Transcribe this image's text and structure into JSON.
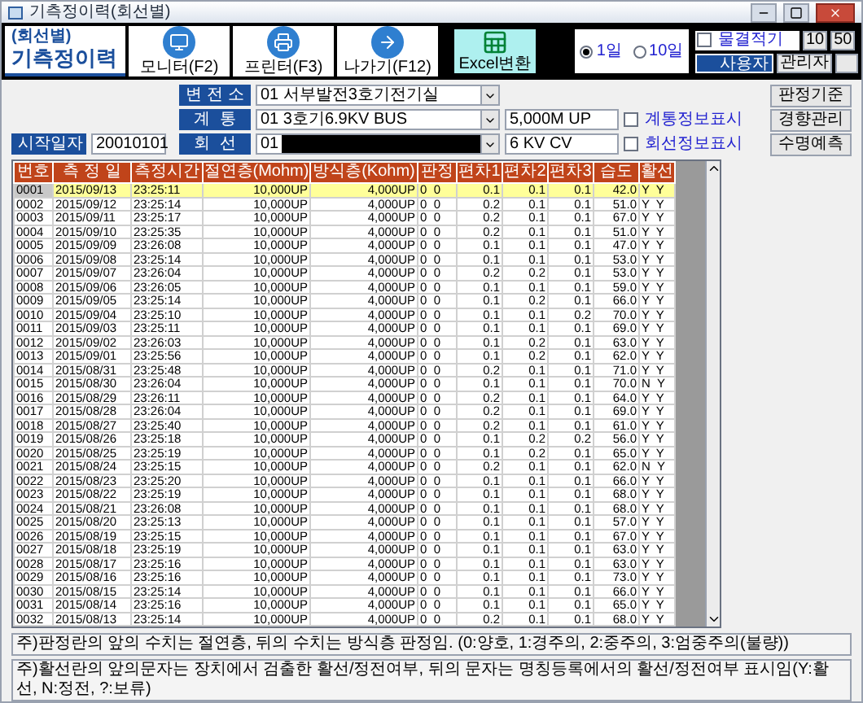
{
  "window": {
    "title": "기측정이력(회선별)"
  },
  "header": {
    "subtitle": "(회선별)",
    "title": "기측정이력"
  },
  "toolbar": [
    {
      "label": "모니터(F2)",
      "kind": "monitor"
    },
    {
      "label": "프린터(F3)",
      "kind": "printer"
    },
    {
      "label": "나가기(F12)",
      "kind": "exit"
    },
    {
      "label": "Excel변환",
      "kind": "excel"
    }
  ],
  "period": [
    {
      "label": "1일",
      "selected": true
    },
    {
      "label": "10일",
      "selected": false
    }
  ],
  "top_right": {
    "checkbox": {
      "label": "물결적기",
      "checked": false
    },
    "values": [
      "10",
      "50"
    ],
    "user_label": "사용자",
    "user": "관리자"
  },
  "filters": {
    "substation": {
      "label": "변 전 소",
      "value": "01 서부발전3호기전기실"
    },
    "system": {
      "label": "계  통",
      "value": "01 3호기6.9KV BUS",
      "info": "5,000M UP",
      "checkbox": {
        "label": "계통정보표시",
        "checked": false
      }
    },
    "start_date": {
      "label": "시작일자",
      "value": "20010101"
    },
    "line": {
      "label": "회  선",
      "value": "01",
      "info": "6 KV CV",
      "checkbox": {
        "label": "회선정보표시",
        "checked": false
      }
    }
  },
  "side_buttons": [
    "판정기준",
    "경향관리",
    "수명예측"
  ],
  "table": {
    "columns": [
      {
        "label": "번호",
        "kind": "text"
      },
      {
        "label": "측 정 일",
        "kind": "text"
      },
      {
        "label": "측정시간",
        "kind": "text"
      },
      {
        "label": "절연층(Mohm)",
        "kind": "number"
      },
      {
        "label": "방식층(Kohm)",
        "kind": "number"
      },
      {
        "label": "판정",
        "kind": "pair"
      },
      {
        "label": "편차1",
        "kind": "number"
      },
      {
        "label": "편차2",
        "kind": "number"
      },
      {
        "label": "편차3",
        "kind": "number"
      },
      {
        "label": "습도",
        "kind": "number"
      },
      {
        "label": "활선",
        "kind": "pair"
      }
    ],
    "rows": [
      {
        "selected": true,
        "cells": [
          "0001",
          "2015/09/13",
          "23:25:11",
          "10,000UP",
          "4,000UP",
          "0  0",
          "0.1",
          "0.1",
          "0.1",
          "42.0",
          "Y  Y"
        ]
      },
      {
        "selected": false,
        "cells": [
          "0002",
          "2015/09/12",
          "23:25:14",
          "10,000UP",
          "4,000UP",
          "0  0",
          "0.2",
          "0.1",
          "0.1",
          "51.0",
          "Y  Y"
        ]
      },
      {
        "selected": false,
        "cells": [
          "0003",
          "2015/09/11",
          "23:25:17",
          "10,000UP",
          "4,000UP",
          "0  0",
          "0.2",
          "0.1",
          "0.1",
          "67.0",
          "Y  Y"
        ]
      },
      {
        "selected": false,
        "cells": [
          "0004",
          "2015/09/10",
          "23:25:35",
          "10,000UP",
          "4,000UP",
          "0  0",
          "0.2",
          "0.1",
          "0.1",
          "51.0",
          "Y  Y"
        ]
      },
      {
        "selected": false,
        "cells": [
          "0005",
          "2015/09/09",
          "23:26:08",
          "10,000UP",
          "4,000UP",
          "0  0",
          "0.1",
          "0.1",
          "0.1",
          "47.0",
          "Y  Y"
        ]
      },
      {
        "selected": false,
        "cells": [
          "0006",
          "2015/09/08",
          "23:25:14",
          "10,000UP",
          "4,000UP",
          "0  0",
          "0.1",
          "0.1",
          "0.1",
          "53.0",
          "Y  Y"
        ]
      },
      {
        "selected": false,
        "cells": [
          "0007",
          "2015/09/07",
          "23:26:04",
          "10,000UP",
          "4,000UP",
          "0  0",
          "0.2",
          "0.2",
          "0.1",
          "53.0",
          "Y  Y"
        ]
      },
      {
        "selected": false,
        "cells": [
          "0008",
          "2015/09/06",
          "23:26:05",
          "10,000UP",
          "4,000UP",
          "0  0",
          "0.1",
          "0.1",
          "0.1",
          "59.0",
          "Y  Y"
        ]
      },
      {
        "selected": false,
        "cells": [
          "0009",
          "2015/09/05",
          "23:25:14",
          "10,000UP",
          "4,000UP",
          "0  0",
          "0.1",
          "0.2",
          "0.1",
          "66.0",
          "Y  Y"
        ]
      },
      {
        "selected": false,
        "cells": [
          "0010",
          "2015/09/04",
          "23:25:10",
          "10,000UP",
          "4,000UP",
          "0  0",
          "0.1",
          "0.1",
          "0.2",
          "70.0",
          "Y  Y"
        ]
      },
      {
        "selected": false,
        "cells": [
          "0011",
          "2015/09/03",
          "23:25:11",
          "10,000UP",
          "4,000UP",
          "0  0",
          "0.1",
          "0.1",
          "0.1",
          "69.0",
          "Y  Y"
        ]
      },
      {
        "selected": false,
        "cells": [
          "0012",
          "2015/09/02",
          "23:26:03",
          "10,000UP",
          "4,000UP",
          "0  0",
          "0.1",
          "0.2",
          "0.1",
          "63.0",
          "Y  Y"
        ]
      },
      {
        "selected": false,
        "cells": [
          "0013",
          "2015/09/01",
          "23:25:56",
          "10,000UP",
          "4,000UP",
          "0  0",
          "0.1",
          "0.2",
          "0.1",
          "62.0",
          "Y  Y"
        ]
      },
      {
        "selected": false,
        "cells": [
          "0014",
          "2015/08/31",
          "23:25:48",
          "10,000UP",
          "4,000UP",
          "0  0",
          "0.2",
          "0.1",
          "0.1",
          "71.0",
          "Y  Y"
        ]
      },
      {
        "selected": false,
        "cells": [
          "0015",
          "2015/08/30",
          "23:26:04",
          "10,000UP",
          "4,000UP",
          "0  0",
          "0.1",
          "0.1",
          "0.1",
          "70.0",
          "N  Y"
        ]
      },
      {
        "selected": false,
        "cells": [
          "0016",
          "2015/08/29",
          "23:26:11",
          "10,000UP",
          "4,000UP",
          "0  0",
          "0.2",
          "0.1",
          "0.1",
          "64.0",
          "Y  Y"
        ]
      },
      {
        "selected": false,
        "cells": [
          "0017",
          "2015/08/28",
          "23:26:04",
          "10,000UP",
          "4,000UP",
          "0  0",
          "0.2",
          "0.1",
          "0.1",
          "69.0",
          "Y  Y"
        ]
      },
      {
        "selected": false,
        "cells": [
          "0018",
          "2015/08/27",
          "23:25:40",
          "10,000UP",
          "4,000UP",
          "0  0",
          "0.2",
          "0.1",
          "0.1",
          "61.0",
          "Y  Y"
        ]
      },
      {
        "selected": false,
        "cells": [
          "0019",
          "2015/08/26",
          "23:25:18",
          "10,000UP",
          "4,000UP",
          "0  0",
          "0.1",
          "0.2",
          "0.2",
          "56.0",
          "Y  Y"
        ]
      },
      {
        "selected": false,
        "cells": [
          "0020",
          "2015/08/25",
          "23:25:19",
          "10,000UP",
          "4,000UP",
          "0  0",
          "0.1",
          "0.2",
          "0.1",
          "65.0",
          "Y  Y"
        ]
      },
      {
        "selected": false,
        "cells": [
          "0021",
          "2015/08/24",
          "23:25:15",
          "10,000UP",
          "4,000UP",
          "0  0",
          "0.2",
          "0.1",
          "0.1",
          "62.0",
          "N  Y"
        ]
      },
      {
        "selected": false,
        "cells": [
          "0022",
          "2015/08/23",
          "23:25:20",
          "10,000UP",
          "4,000UP",
          "0  0",
          "0.1",
          "0.1",
          "0.1",
          "66.0",
          "Y  Y"
        ]
      },
      {
        "selected": false,
        "cells": [
          "0023",
          "2015/08/22",
          "23:25:19",
          "10,000UP",
          "4,000UP",
          "0  0",
          "0.1",
          "0.1",
          "0.1",
          "68.0",
          "Y  Y"
        ]
      },
      {
        "selected": false,
        "cells": [
          "0024",
          "2015/08/21",
          "23:26:08",
          "10,000UP",
          "4,000UP",
          "0  0",
          "0.1",
          "0.1",
          "0.1",
          "68.0",
          "Y  Y"
        ]
      },
      {
        "selected": false,
        "cells": [
          "0025",
          "2015/08/20",
          "23:25:13",
          "10,000UP",
          "4,000UP",
          "0  0",
          "0.1",
          "0.1",
          "0.1",
          "57.0",
          "Y  Y"
        ]
      },
      {
        "selected": false,
        "cells": [
          "0026",
          "2015/08/19",
          "23:25:15",
          "10,000UP",
          "4,000UP",
          "0  0",
          "0.1",
          "0.1",
          "0.1",
          "67.0",
          "Y  Y"
        ]
      },
      {
        "selected": false,
        "cells": [
          "0027",
          "2015/08/18",
          "23:25:19",
          "10,000UP",
          "4,000UP",
          "0  0",
          "0.1",
          "0.1",
          "0.1",
          "63.0",
          "Y  Y"
        ]
      },
      {
        "selected": false,
        "cells": [
          "0028",
          "2015/08/17",
          "23:25:16",
          "10,000UP",
          "4,000UP",
          "0  0",
          "0.1",
          "0.1",
          "0.1",
          "63.0",
          "Y  Y"
        ]
      },
      {
        "selected": false,
        "cells": [
          "0029",
          "2015/08/16",
          "23:25:16",
          "10,000UP",
          "4,000UP",
          "0  0",
          "0.1",
          "0.1",
          "0.1",
          "73.0",
          "Y  Y"
        ]
      },
      {
        "selected": false,
        "cells": [
          "0030",
          "2015/08/15",
          "23:25:14",
          "10,000UP",
          "4,000UP",
          "0  0",
          "0.1",
          "0.1",
          "0.1",
          "66.0",
          "Y  Y"
        ]
      },
      {
        "selected": false,
        "cells": [
          "0031",
          "2015/08/14",
          "23:25:16",
          "10,000UP",
          "4,000UP",
          "0  0",
          "0.1",
          "0.1",
          "0.1",
          "65.0",
          "Y  Y"
        ]
      },
      {
        "selected": false,
        "cells": [
          "0032",
          "2015/08/13",
          "23:25:14",
          "10,000UP",
          "4,000UP",
          "0  0",
          "0.2",
          "0.1",
          "0.1",
          "68.0",
          "Y  Y"
        ]
      }
    ]
  },
  "notes": [
    "주)판정란의 앞의 수치는 절연층, 뒤의 수치는 방식층 판정임. (0:양호, 1:경주의, 2:중주의, 3:엄중주의(불량))",
    "주)활선란의 앞의문자는 장치에서 검출한 활선/정전여부, 뒤의 문자는 명칭등록에서의 활선/정전여부 표시임(Y:활선, N:정전, ?:보류)"
  ]
}
